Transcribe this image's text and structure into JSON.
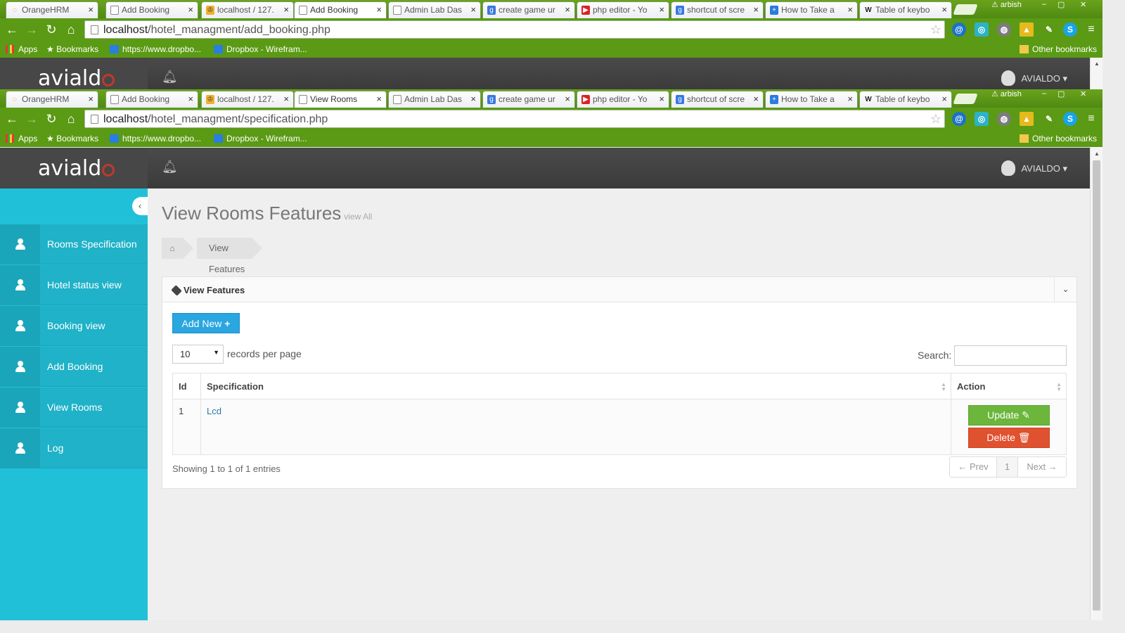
{
  "browser_back": {
    "tabs": [
      {
        "title": "OrangeHRM",
        "icon": "orangehrm-icon"
      },
      {
        "title": "Add Booking",
        "icon": "page-icon"
      },
      {
        "title": "localhost / 127.",
        "icon": "phpmyadmin-icon"
      },
      {
        "title": "Add Booking",
        "icon": "page-icon",
        "active": true
      },
      {
        "title": "Admin Lab Das",
        "icon": "page-icon"
      },
      {
        "title": "create game ur",
        "icon": "google-icon"
      },
      {
        "title": "php editor - Yo",
        "icon": "youtube-icon"
      },
      {
        "title": "shortcut of scre",
        "icon": "google-icon"
      },
      {
        "title": "How to Take a",
        "icon": "wikihow-icon"
      },
      {
        "title": "Table of keybo",
        "icon": "wikipedia-icon"
      }
    ],
    "profile": "arbish",
    "url_host": "localhost",
    "url_path": "/hotel_managment/add_booking.php"
  },
  "browser_front": {
    "tabs": [
      {
        "title": "OrangeHRM",
        "icon": "orangehrm-icon"
      },
      {
        "title": "Add Booking",
        "icon": "page-icon"
      },
      {
        "title": "localhost / 127.",
        "icon": "phpmyadmin-icon"
      },
      {
        "title": "View Rooms",
        "icon": "page-icon",
        "active": true
      },
      {
        "title": "Admin Lab Das",
        "icon": "page-icon"
      },
      {
        "title": "create game ur",
        "icon": "google-icon"
      },
      {
        "title": "php editor - Yo",
        "icon": "youtube-icon"
      },
      {
        "title": "shortcut of scre",
        "icon": "google-icon"
      },
      {
        "title": "How to Take a",
        "icon": "wikihow-icon"
      },
      {
        "title": "Table of keybo",
        "icon": "wikipedia-icon"
      }
    ],
    "profile": "arbish",
    "url_host": "localhost",
    "url_path": "/hotel_managment/specification.php"
  },
  "bookmarks": {
    "apps": "Apps",
    "bookmarks": "Bookmarks",
    "dropbox_url": "https://www.dropbo...",
    "dropbox_wire": "Dropbox - Wirefram...",
    "other": "Other bookmarks"
  },
  "app": {
    "logo": "aviald",
    "user": "AVIALDO"
  },
  "sidebar": {
    "items": [
      {
        "label": "Rooms Specification"
      },
      {
        "label": "Hotel status view"
      },
      {
        "label": "Booking view"
      },
      {
        "label": "Add Booking"
      },
      {
        "label": "View Rooms"
      },
      {
        "label": "Log"
      }
    ]
  },
  "page": {
    "title": "View Rooms Features",
    "subtitle": "view All",
    "breadcrumb": "View Features"
  },
  "panel": {
    "title": "View Features",
    "add_button": "Add New",
    "page_size": "10",
    "records_per_page": "records per page",
    "search_label": "Search:",
    "search_value": "",
    "columns": [
      "Id",
      "Specification",
      "Action"
    ],
    "rows": [
      {
        "id": "1",
        "specification": "Lcd"
      }
    ],
    "update_label": "Update",
    "delete_label": "Delete",
    "info": "Showing 1 to 1 of 1 entries",
    "prev": "← Prev",
    "page": "1",
    "next": "Next →"
  },
  "colors": {
    "chrome_green": "#5b9a14",
    "sidebar": "#20c0d8",
    "add_button": "#2aa6e0",
    "update_button": "#6bb63b",
    "delete_button": "#e0512f"
  }
}
